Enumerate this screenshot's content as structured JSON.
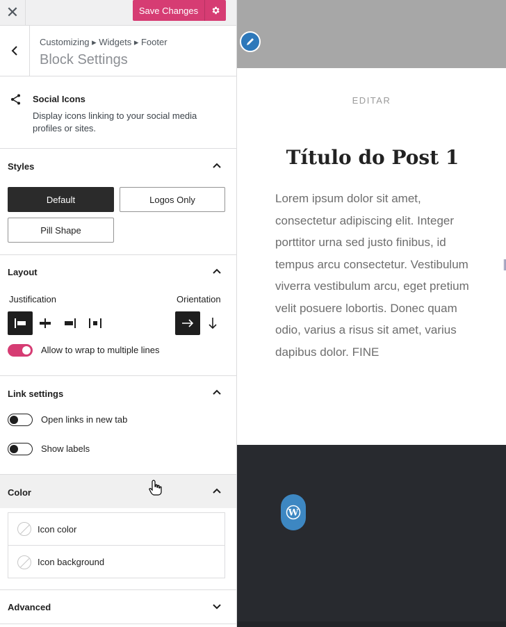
{
  "topbar": {
    "close_icon": "close-icon",
    "save_label": "Save Changes",
    "gear_icon": "gear-icon"
  },
  "header": {
    "breadcrumb": "Customizing ▸ Widgets ▸ Footer",
    "title": "Block Settings"
  },
  "block": {
    "name": "Social Icons",
    "description": "Display icons linking to your social media profiles or sites.",
    "icon": "share-icon"
  },
  "styles": {
    "title": "Styles",
    "options": [
      "Default",
      "Logos Only",
      "Pill Shape"
    ],
    "selected": "Default"
  },
  "layout": {
    "title": "Layout",
    "justification_label": "Justification",
    "orientation_label": "Orientation",
    "wrap_label": "Allow to wrap to multiple lines",
    "wrap_enabled": true
  },
  "link_settings": {
    "title": "Link settings",
    "new_tab_label": "Open links in new tab",
    "new_tab_enabled": false,
    "show_labels_label": "Show labels",
    "show_labels_enabled": false
  },
  "color": {
    "title": "Color",
    "items": [
      "Icon color",
      "Icon background"
    ]
  },
  "advanced": {
    "title": "Advanced"
  },
  "preview": {
    "edit_label": "EDITAR",
    "post_title": "Título do Post 1",
    "post_body": "Lorem ipsum dolor sit amet, consectetur adipiscing elit. Integer porttitor urna sed justo finibus, id tempus arcu consectetur. Vestibulum viverra vestibulum arcu, eget pretium velit posuere lobortis. Donec quam odio, varius a risus sit amet, varius dapibus dolor. FINE"
  },
  "colors": {
    "accent": "#d63c73",
    "footer_bg": "#282a2f",
    "header_bg": "#a7a7a7",
    "wp_blue": "#3d87c2"
  }
}
